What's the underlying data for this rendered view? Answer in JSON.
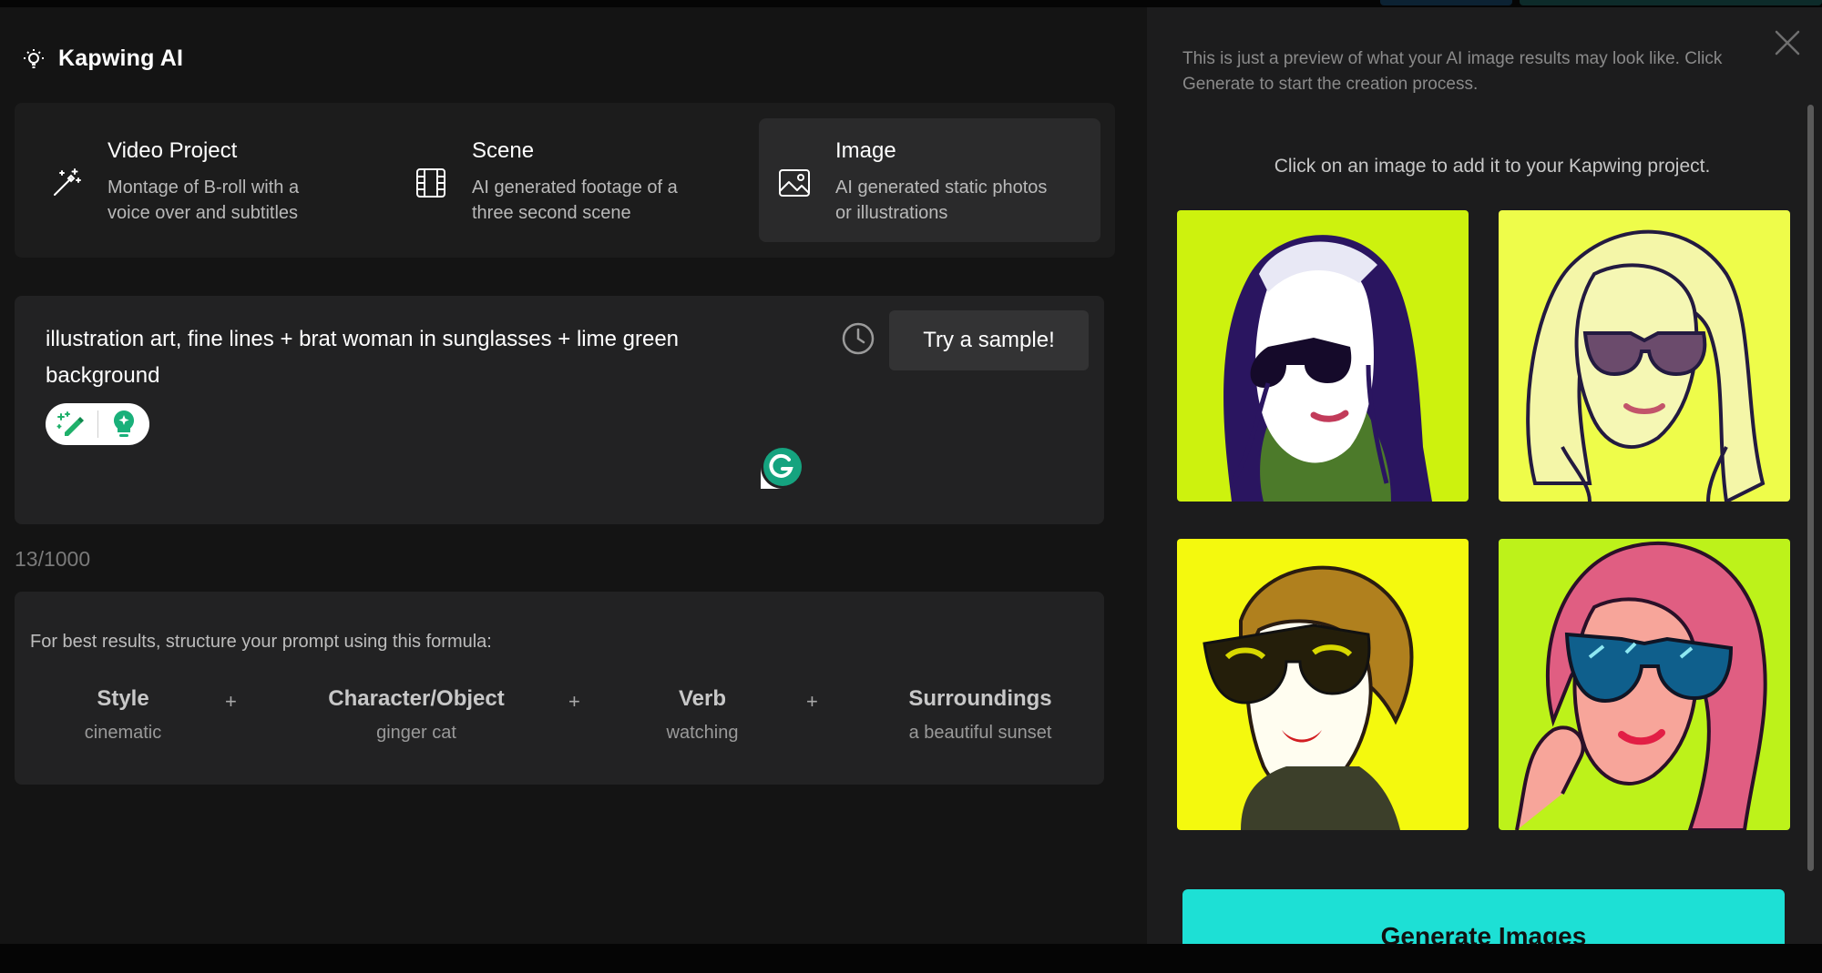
{
  "brand": {
    "title": "Kapwing AI",
    "icon": "lightbulb-icon"
  },
  "modes": [
    {
      "title": "Video Project",
      "desc1": "Montage of B-roll with a",
      "desc2": "voice over and subtitles",
      "icon": "magic-wand-icon"
    },
    {
      "title": "Scene",
      "desc1": "AI generated footage of a",
      "desc2": "three second scene",
      "icon": "film-icon"
    },
    {
      "title": "Image",
      "desc1": "AI generated static photos",
      "desc2": "or illustrations",
      "icon": "image-icon",
      "selected": true
    }
  ],
  "prompt": {
    "text": "illustration art, fine lines + brat woman in sunglasses + lime green background",
    "sample_button": "Try a sample!",
    "counter": "13/1000"
  },
  "formula": {
    "heading": "For best results, structure your prompt using this formula:",
    "parts": [
      {
        "title": "Style",
        "example": "cinematic"
      },
      {
        "title": "Character/Object",
        "example": "ginger cat"
      },
      {
        "title": "Verb",
        "example": "watching"
      },
      {
        "title": "Surroundings",
        "example": "a beautiful sunset"
      }
    ],
    "separator": "+"
  },
  "preview": {
    "note": "This is just a preview of what your AI image results may look like. Click Generate to start the creation process.",
    "hint": "Click on an image to add it to your Kapwing project.",
    "images": [
      {
        "bg": "#cdf20e"
      },
      {
        "bg": "#eefc4a"
      },
      {
        "bg": "#f4f90e"
      },
      {
        "bg": "#bdf21a"
      }
    ],
    "generate_button": "Generate Images"
  },
  "colors": {
    "accent": "#1de0d5",
    "panel": "#1c1c1d",
    "background": "#141414"
  }
}
